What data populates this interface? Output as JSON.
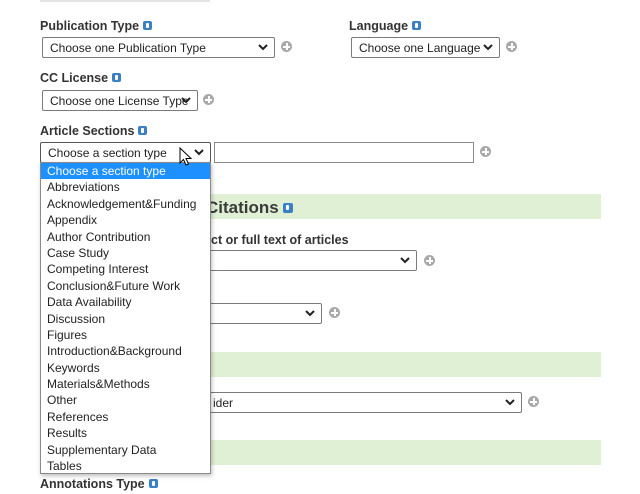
{
  "publication_type": {
    "label": "Publication Type",
    "selected": "Choose one Publication Type"
  },
  "language": {
    "label": "Language",
    "selected": "Choose one Language"
  },
  "cc_license": {
    "label": "CC License",
    "selected": "Choose one License Type"
  },
  "article_sections": {
    "label": "Article Sections",
    "selected": "Choose a section type",
    "text_value": "",
    "options": [
      "Choose a section type",
      "Abbreviations",
      "Acknowledgement&Funding",
      "Appendix",
      "Author Contribution",
      "Case Study",
      "Competing Interest",
      "Conclusion&Future Work",
      "Data Availability",
      "Discussion",
      "Figures",
      "Introduction&Background",
      "Keywords",
      "Materials&Methods",
      "Other",
      "References",
      "Results",
      "Supplementary Data",
      "Tables"
    ]
  },
  "citations": {
    "title_partial": "Citations",
    "field_partial": "ct or full text of articles"
  },
  "provider_partial": "ider",
  "annotations_type": {
    "label": "Annotations Type"
  }
}
